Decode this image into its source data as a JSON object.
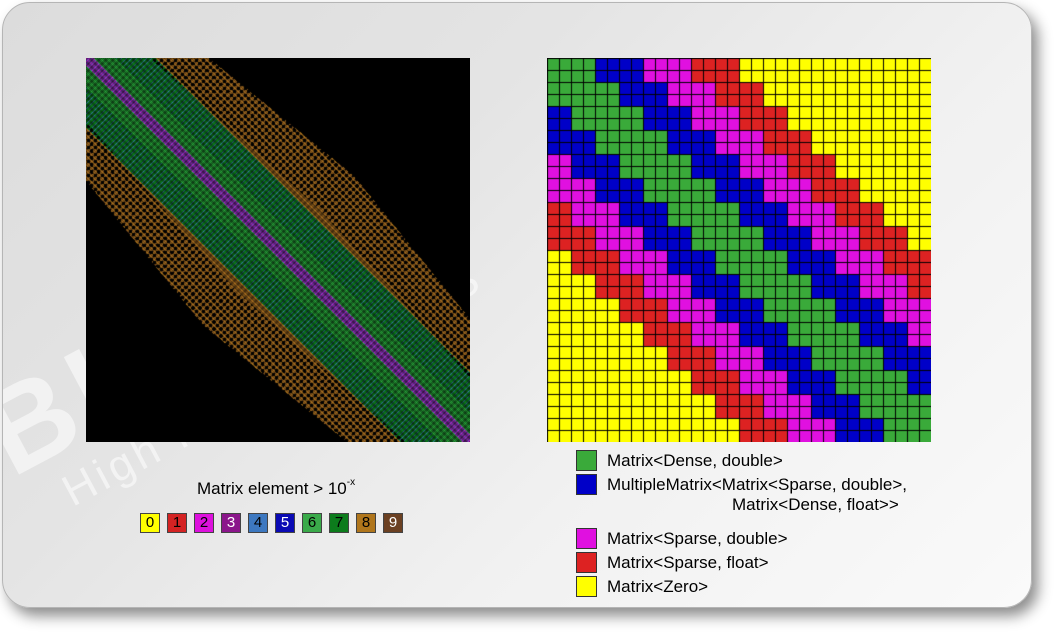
{
  "watermark": {
    "big": "BLAZ",
    "small": "High Performance S"
  },
  "heatmap": {
    "background": "#000000"
  },
  "scale": {
    "title_main": "Matrix element > 10",
    "title_exp": "-x",
    "items": [
      {
        "label": "0",
        "color": "#ffff00",
        "text": "#000000"
      },
      {
        "label": "1",
        "color": "#d42323",
        "text": "#000000"
      },
      {
        "label": "2",
        "color": "#dd11dd",
        "text": "#000000"
      },
      {
        "label": "3",
        "color": "#8b168b",
        "text": "#ffffff"
      },
      {
        "label": "4",
        "color": "#3d78c0",
        "text": "#000000"
      },
      {
        "label": "5",
        "color": "#0a0ab4",
        "text": "#ffffff"
      },
      {
        "label": "6",
        "color": "#3aaa4a",
        "text": "#000000"
      },
      {
        "label": "7",
        "color": "#0c7c1c",
        "text": "#000000"
      },
      {
        "label": "8",
        "color": "#b0761c",
        "text": "#000000"
      },
      {
        "label": "9",
        "color": "#6b4022",
        "text": "#ffffff"
      }
    ]
  },
  "legend": [
    {
      "color": "#3aaa3a",
      "line1": "Matrix<Dense, double>",
      "line2": ""
    },
    {
      "color": "#0000c8",
      "line1": "MultipleMatrix<Matrix<Sparse, double>,",
      "line2": "Matrix<Dense, float>>"
    },
    {
      "color": "#e010e0",
      "line1": "Matrix<Sparse, double>",
      "line2": ""
    },
    {
      "color": "#dd2222",
      "line1": "Matrix<Sparse, float>",
      "line2": ""
    },
    {
      "color": "#ffff00",
      "line1": "Matrix<Zero>",
      "line2": ""
    }
  ]
}
